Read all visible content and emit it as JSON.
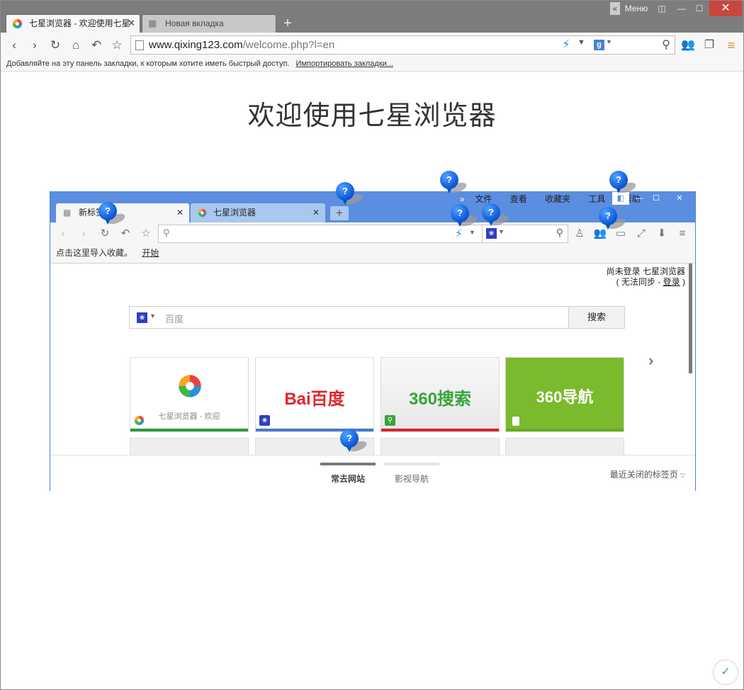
{
  "browser": {
    "tabs": [
      {
        "title": "七星浏览器 - 欢迎使用七星"
      },
      {
        "title": "Новая вкладка"
      }
    ],
    "menu_label": "Меню",
    "address": {
      "host": "www.qixing123.com",
      "path": "/welcome.php?l=en"
    },
    "bookmarks_bar": {
      "text": "Добавляйте на эту панель закладки, к которым хотите иметь быстрый доступ.",
      "import_link": "Импортировать закладки..."
    }
  },
  "content": {
    "heading": "欢迎使用七星浏览器",
    "illustration": {
      "menu": [
        "文件",
        "查看",
        "收藏夹",
        "工具",
        "帮助"
      ],
      "tabs": [
        {
          "title": "新标签页"
        },
        {
          "title": "七星浏览器"
        }
      ],
      "bookmarks": {
        "text": "点击这里导入收藏。",
        "start": "开始"
      },
      "login": {
        "line1": "尚未登录 七星浏览器",
        "line2_prefix": "( 无法同步 - ",
        "line2_link": "登录",
        "line2_suffix": " )"
      },
      "search": {
        "placeholder": "百度",
        "button": "搜索"
      },
      "tiles": [
        {
          "caption": "七星浏览器 - 欢迎",
          "logo": "",
          "bar_color": "#2e9a3a"
        },
        {
          "caption": "",
          "logo": "Bai百度",
          "bar_color": "#4a78c8"
        },
        {
          "caption": "",
          "logo": "360搜索",
          "bar_color": "#d9232d"
        },
        {
          "caption": "",
          "logo": "360导航",
          "bar_color": "#6aaa24"
        }
      ],
      "bottom_tabs": [
        "常去网站",
        "影视导航"
      ],
      "recently_closed": "最近关闭的标签页",
      "pin_label": "?"
    }
  }
}
